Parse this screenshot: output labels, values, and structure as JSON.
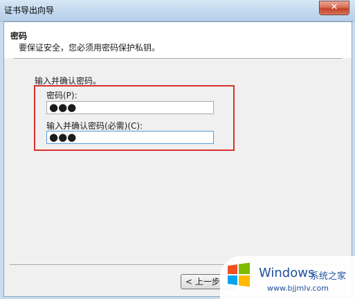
{
  "window": {
    "title": "证书导出向导",
    "close_label": "✕"
  },
  "header": {
    "title": "密码",
    "description": "要保证安全，您必须用密码保护私钥。"
  },
  "form": {
    "instruction": "输入并确认密码。",
    "password_label": "密码(P):",
    "password_value": "●●●",
    "confirm_label": "输入并确认密码(必需)(C):",
    "confirm_value": "●●●"
  },
  "buttons": {
    "back_label": "< 上一步"
  },
  "watermark": {
    "brand": "Windows",
    "site_name": "系统之家",
    "url": "www.bjjmlv.com"
  },
  "colors": {
    "highlight": "#d9302a",
    "logo": [
      "#f25022",
      "#7fba00",
      "#00a4ef",
      "#ffb900"
    ]
  }
}
